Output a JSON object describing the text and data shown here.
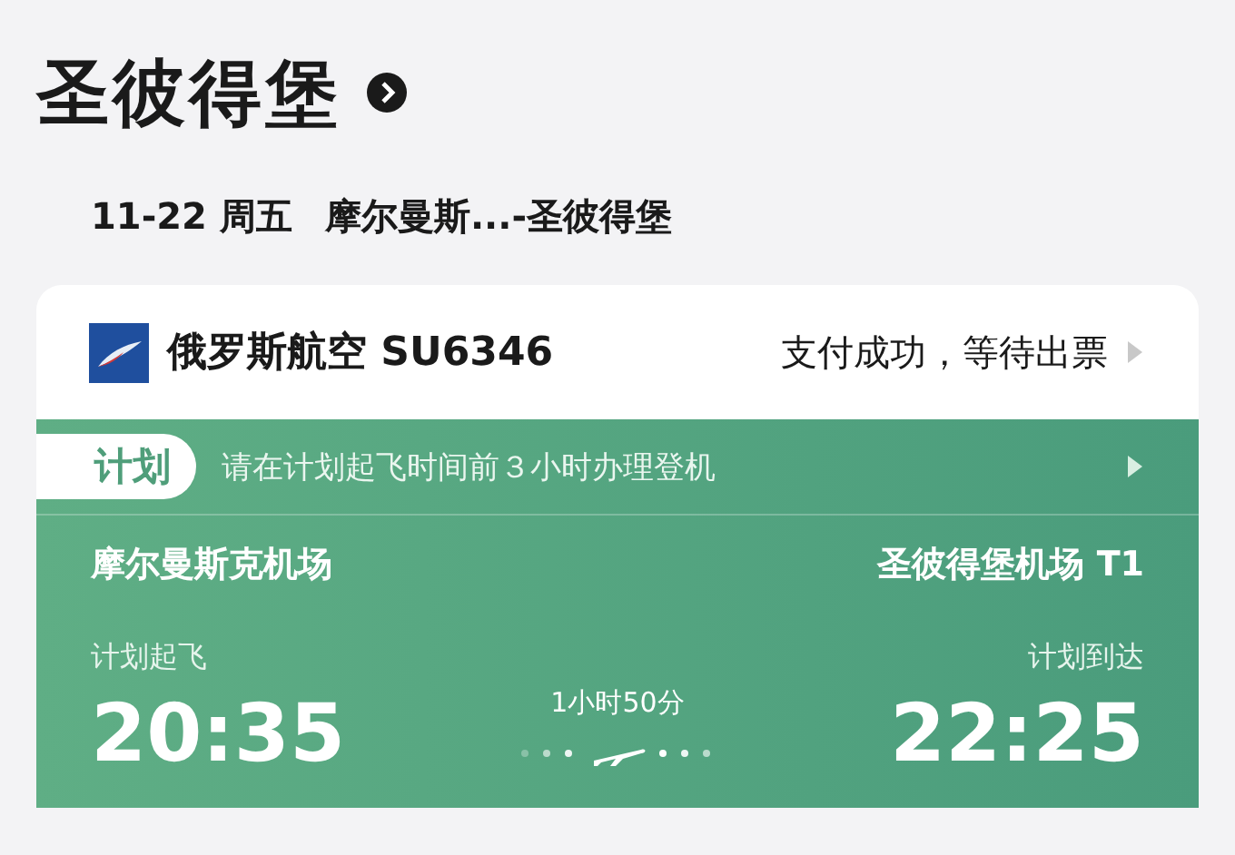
{
  "header": {
    "title": "圣彼得堡"
  },
  "trip": {
    "date": "11-22 周五",
    "route": "摩尔曼斯...-圣彼得堡"
  },
  "flight": {
    "airline": "俄罗斯航空 SU6346",
    "status": "支付成功，等待出票"
  },
  "notice": {
    "badge": "计划",
    "text": "请在计划起飞时间前３小时办理登机"
  },
  "departure": {
    "airport": "摩尔曼斯克机场",
    "label": "计划起飞",
    "time": "20:35"
  },
  "arrival": {
    "airport": "圣彼得堡机场 T1",
    "label": "计划到达",
    "time": "22:25"
  },
  "duration": "1小时50分"
}
